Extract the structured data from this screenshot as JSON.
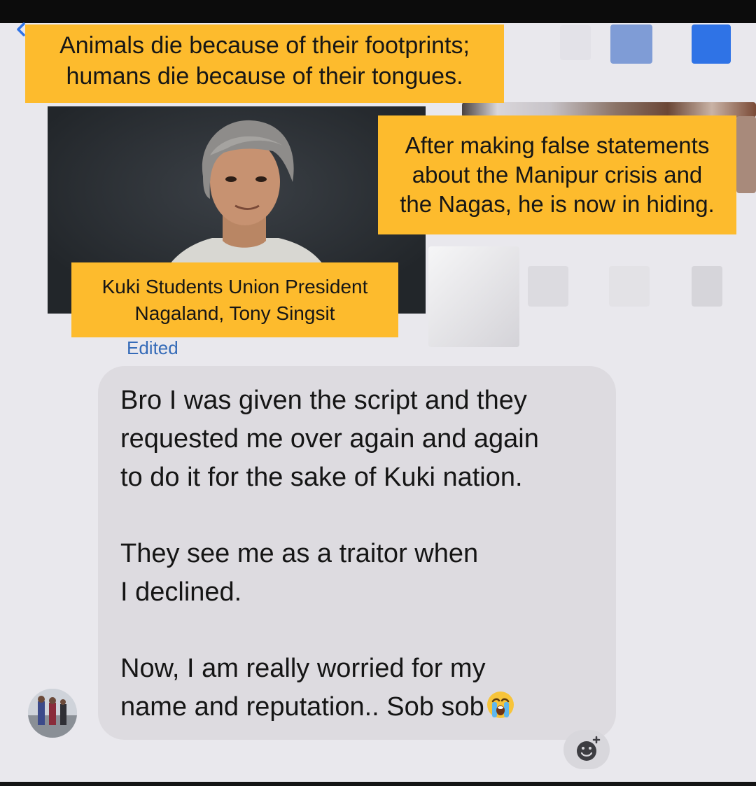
{
  "captions": {
    "quote_line1": "Animals die because of their footprints;",
    "quote_line2": "humans die because of their tongues.",
    "statement_line1": "After making false statements",
    "statement_line2": "about the Manipur crisis and",
    "statement_line3": "the Nagas, he is now in hiding.",
    "name_line1": "Kuki Students Union President",
    "name_line2": "Nagaland, Tony Singsit"
  },
  "conversation": {
    "edited_label": "Edited",
    "message": {
      "para1_line1": "Bro I was given the script and they",
      "para1_line2": "requested me over again and again",
      "para1_line3": "to do it for the sake of Kuki nation.",
      "para2_line1": "They see me as a traitor when",
      "para2_line2": "I declined.",
      "para3_line1": "Now, I am really worried for my",
      "para3_line2": "name and reputation.. Sob sob"
    }
  },
  "icons": {
    "back": "chevron-left-icon",
    "emoji": "loudly-crying-face-emoji",
    "reaction": "add-reaction-icon"
  },
  "colors": {
    "caption_background": "#fdbb2d",
    "accent": "#2f73e6",
    "bubble": "#dddbe0",
    "background": "#e9e8ed"
  }
}
